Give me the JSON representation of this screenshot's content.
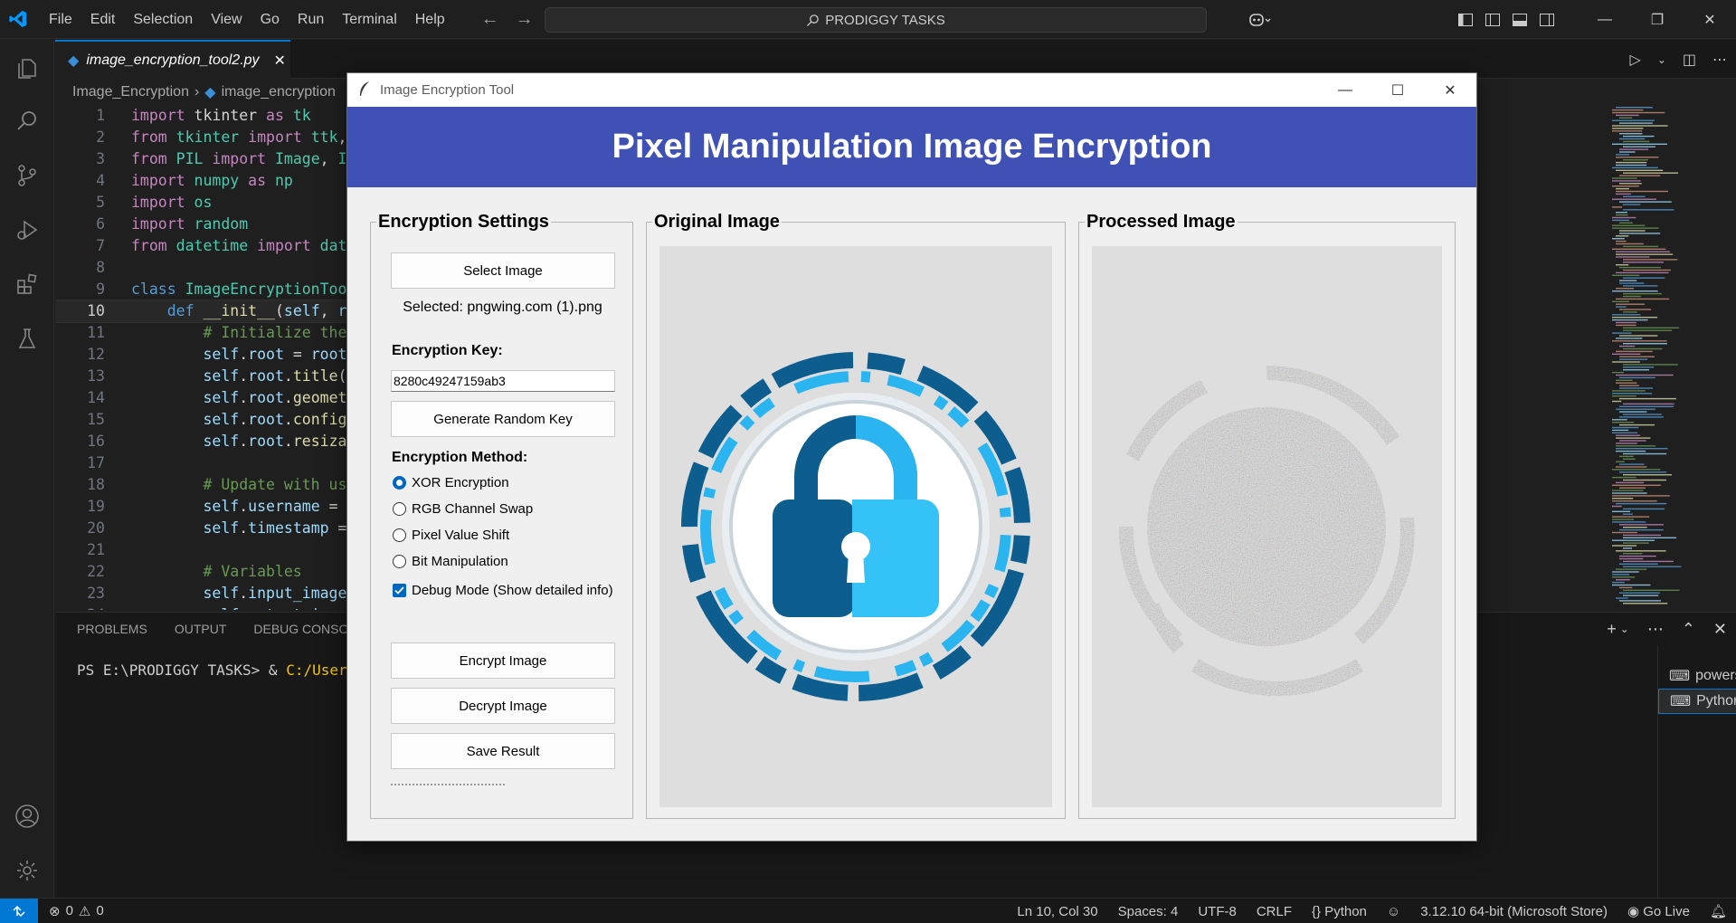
{
  "menu": [
    "File",
    "Edit",
    "Selection",
    "View",
    "Go",
    "Run",
    "Terminal",
    "Help"
  ],
  "search": {
    "text": "PRODIGGY TASKS"
  },
  "tab": {
    "filename": "image_encryption_tool2.py"
  },
  "breadcrumb": {
    "folder": "Image_Encryption",
    "file": "image_encryption"
  },
  "code_lines": [
    {
      "n": "1",
      "t": "import tkinter as tk"
    },
    {
      "n": "2",
      "t": "from tkinter import ttk,"
    },
    {
      "n": "3",
      "t": "from PIL import Image, Im"
    },
    {
      "n": "4",
      "t": "import numpy as np"
    },
    {
      "n": "5",
      "t": "import os"
    },
    {
      "n": "6",
      "t": "import random"
    },
    {
      "n": "7",
      "t": "from datetime import date"
    },
    {
      "n": "8",
      "t": ""
    },
    {
      "n": "9",
      "t": "class ImageEncryptionTool"
    },
    {
      "n": "10",
      "t": "    def __init__(self, ro"
    },
    {
      "n": "11",
      "t": "        # Initialize the"
    },
    {
      "n": "12",
      "t": "        self.root = root"
    },
    {
      "n": "13",
      "t": "        self.root.title(\""
    },
    {
      "n": "14",
      "t": "        self.root.geometr"
    },
    {
      "n": "15",
      "t": "        self.root.configu"
    },
    {
      "n": "16",
      "t": "        self.root.resizab"
    },
    {
      "n": "17",
      "t": ""
    },
    {
      "n": "18",
      "t": "        # Update with use"
    },
    {
      "n": "19",
      "t": "        self.username = \""
    },
    {
      "n": "20",
      "t": "        self.timestamp ="
    },
    {
      "n": "21",
      "t": ""
    },
    {
      "n": "22",
      "t": "        # Variables"
    },
    {
      "n": "23",
      "t": "        self.input_image_"
    },
    {
      "n": "24",
      "t": "        self.output_image"
    }
  ],
  "panel": {
    "tabs": [
      "PROBLEMS",
      "OUTPUT",
      "DEBUG CONSOLE"
    ],
    "prompt": "PS E:\\PRODIGGY TASKS> & ",
    "path": "C:/Users/",
    "terminals": [
      "powershell",
      "Python"
    ]
  },
  "status": {
    "errors": "0",
    "warnings": "0",
    "position": "Ln 10, Col 30",
    "spaces": "Spaces: 4",
    "encoding": "UTF-8",
    "eol": "CRLF",
    "language": "{} Python",
    "interpreter": "3.12.10 64-bit (Microsoft Store)",
    "golive": "Go Live"
  },
  "app": {
    "window_title": "Image Encryption Tool",
    "banner_title": "Pixel Manipulation Image Encryption",
    "banner_color": "#3f51b5",
    "settings_label": "Encryption Settings",
    "original_label": "Original Image",
    "processed_label": "Processed Image",
    "select_button": "Select Image",
    "selected_text": "Selected: pngwing.com (1).png",
    "key_label": "Encryption Key:",
    "key_value": "8280c49247159ab3",
    "generate_button": "Generate Random Key",
    "method_label": "Encryption Method:",
    "methods": [
      "XOR Encryption",
      "RGB Channel Swap",
      "Pixel Value Shift",
      "Bit Manipulation"
    ],
    "selected_method": "XOR Encryption",
    "debug_label": "Debug Mode (Show detailed info)",
    "debug_checked": true,
    "encrypt_button": "Encrypt Image",
    "decrypt_button": "Decrypt Image",
    "save_button": "Save Result"
  }
}
